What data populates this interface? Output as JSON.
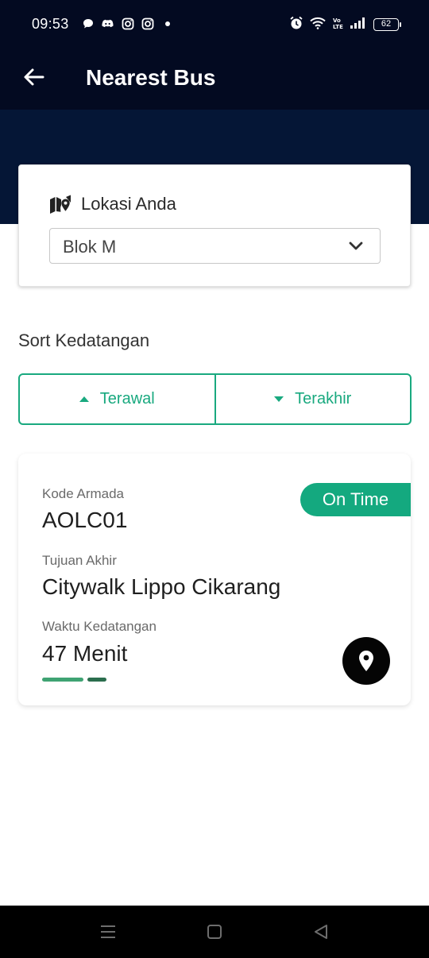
{
  "status_bar": {
    "time": "09:53",
    "left_icons": [
      "chat-bubble-icon",
      "discord-icon",
      "instagram-icon",
      "instagram-icon",
      "dot-icon"
    ],
    "right_icons": [
      "alarm-icon",
      "wifi-icon",
      "volte-icon",
      "signal-icon"
    ],
    "battery": "62"
  },
  "app_bar": {
    "title": "Nearest Bus",
    "back_icon": "arrow-left-icon"
  },
  "location": {
    "label": "Lokasi Anda",
    "icon": "map-icon",
    "selected": "Blok M"
  },
  "sort": {
    "title": "Sort Kedatangan",
    "earliest_label": "Terawal",
    "latest_label": "Terakhir"
  },
  "bus": {
    "status": "On Time",
    "fleet_label": "Kode Armada",
    "fleet_value": "AOLC01",
    "destination_label": "Tujuan Akhir",
    "destination_value": "Citywalk Lippo Cikarang",
    "arrival_label": "Waktu Kedatangan",
    "arrival_value": "47 Menit"
  },
  "colors": {
    "header": "#030a21",
    "hero": "#051636",
    "accent": "#19a97f"
  }
}
